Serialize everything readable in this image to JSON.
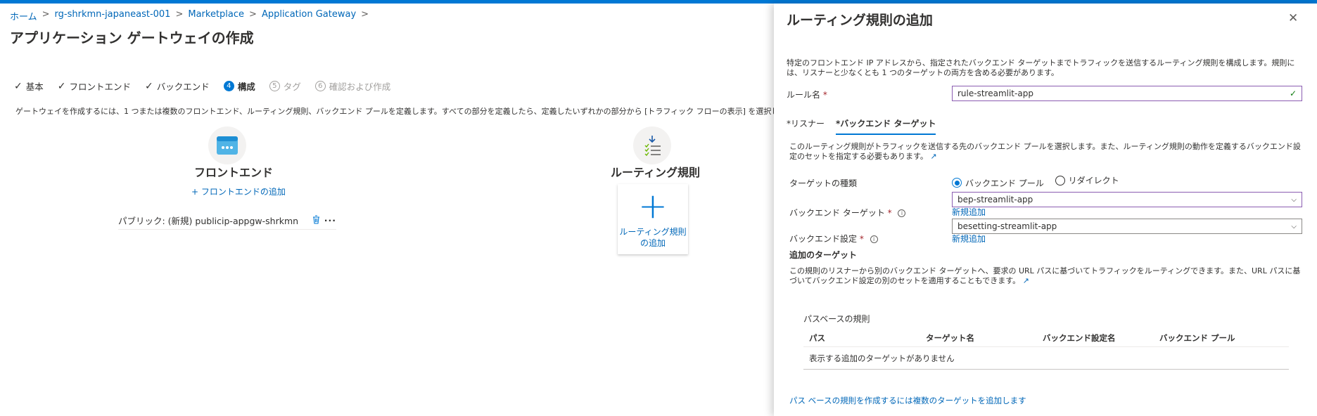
{
  "breadcrumb": [
    "ホーム",
    "rg-shrkmn-japaneast-001",
    "Marketplace",
    "Application Gateway"
  ],
  "page_title": "アプリケーション ゲートウェイの作成",
  "more_label": "…",
  "steps": [
    {
      "marker": "✓",
      "label": "基本"
    },
    {
      "marker": "✓",
      "label": "フロントエンド"
    },
    {
      "marker": "✓",
      "label": "バックエンド"
    },
    {
      "marker": "4",
      "label": "構成"
    },
    {
      "marker": "5",
      "label": "タグ"
    },
    {
      "marker": "6",
      "label": "確認および作成"
    }
  ],
  "description": "ゲートウェイを作成するには、1 つまたは複数のフロントエンド、ルーティング規則、バックエンド プールを定義します。すべての部分を定義したら、定義したいずれかの部分から [トラフィック フローの表示] を選択して、トラフィックがゲートウェイを通",
  "frontend": {
    "title": "フロントエンド",
    "add_link": "+ フロントエンドの追加",
    "item": "パブリック: (新規) publicip-appgw-shrkmn",
    "item_more": "···"
  },
  "routing": {
    "title": "ルーティング規則",
    "add_plus": "+",
    "add_label_line1": "ルーティング規則",
    "add_label_line2": "の追加"
  },
  "panel": {
    "title": "ルーティング規則の追加",
    "close": "✕",
    "description": "特定のフロントエンド IP アドレスから、指定されたバックエンド ターゲットまでトラフィックを送信するルーティング規則を構成します。規則には、リスナーと少なくとも 1 つのターゲットの両方を含める必要があります。",
    "rule_name_label": "ルール名",
    "required_mark": "*",
    "rule_name_value": "rule-streamlit-app",
    "tabs": [
      "*リスナー",
      "*バックエンド ターゲット"
    ],
    "target_desc": "このルーティング規則がトラフィックを送信する先のバックエンド プールを選択します。また、ルーティング規則の動作を定義するバックエンド設定のセットを指定する必要もあります。",
    "target_type_label": "ターゲットの種類",
    "radio_options": [
      "バックエンド プール",
      "リダイレクト"
    ],
    "backend_target_label": "バックエンド ターゲット",
    "backend_target_value": "bep-streamlit-app",
    "new_link_1": "新規追加",
    "backend_settings_label": "バックエンド設定",
    "backend_settings_value": "besetting-streamlit-app",
    "new_link_2": "新規追加",
    "additional_title": "追加のターゲット",
    "additional_desc": "この規則のリスナーから別のバックエンド ターゲットへ、要求の URL パスに基づいてトラフィックをルーティングできます。また、URL パスに基づいてバックエンド設定の別のセットを適用することもできます。",
    "path_rules_title": "パスベースの規則",
    "columns": [
      "パス",
      "ターゲット名",
      "バックエンド設定名",
      "バックエンド プール"
    ],
    "empty_text": "表示する追加のターゲットがありません",
    "bottom_link": "パス ベースの規則を作成するには複数のターゲットを追加します"
  }
}
